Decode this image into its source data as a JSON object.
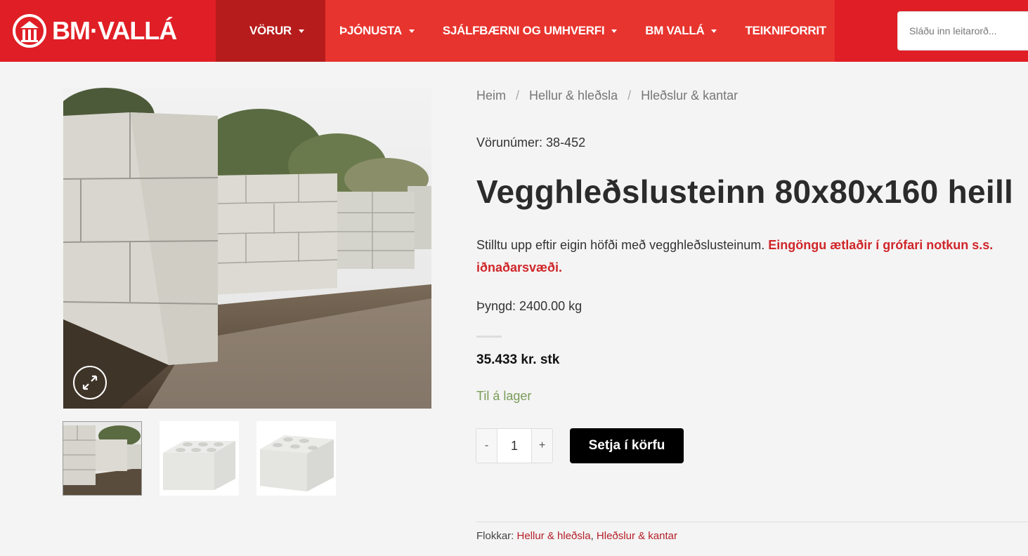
{
  "header": {
    "logo_text": "BM·VALLÁ",
    "nav": [
      {
        "label": "VÖRUR",
        "has_dropdown": true,
        "active": true
      },
      {
        "label": "ÞJÓNUSTA",
        "has_dropdown": true
      },
      {
        "label": "SJÁLFBÆRNI OG UMHVERFI",
        "has_dropdown": true
      },
      {
        "label": "BM VALLÁ",
        "has_dropdown": true
      },
      {
        "label": "TEIKNIFORRIT",
        "has_dropdown": false
      }
    ],
    "search_placeholder": "Sláðu inn leitarorð..."
  },
  "breadcrumb": [
    "Heim",
    "Hellur & hleðsla",
    "Hleðslur & kantar"
  ],
  "product": {
    "sku_label": "Vörunúmer: 38-452",
    "title": "Vegghleðslusteinn 80x80x160 heill",
    "description": "Stilltu upp eftir eigin höfði með vegghleðslusteinum.",
    "warning": "Eingöngu ætlaðir í grófari notkun s.s. iðnaðarsvæði.",
    "weight": "Þyngd: 2400.00 kg",
    "price": "35.433 kr. stk",
    "stock": "Til á lager",
    "quantity": "1",
    "qty_minus": "-",
    "qty_plus": "+",
    "add_to_cart": "Setja í körfu"
  },
  "categories": {
    "label": "Flokkar:",
    "items": [
      "Hellur & hleðsla",
      "Hleðslur & kantar"
    ],
    "separator": ","
  },
  "colors": {
    "header_red": "#e01e25",
    "nav_active": "#b71c1c",
    "warning_red": "#d0262a",
    "stock_green": "#7a9c59",
    "button_black": "#000000"
  },
  "icons": [
    "logo-icon",
    "expand-icon",
    "caret-down-icon"
  ]
}
